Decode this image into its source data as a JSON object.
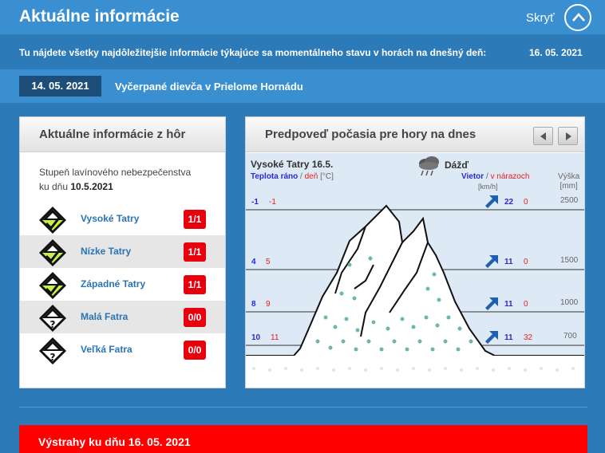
{
  "header": {
    "title": "Aktuálne informácie",
    "hide_label": "Skryť"
  },
  "intro": {
    "text": "Tu nájdete všetky najdôležitejšie informácie týkajúce sa momentálneho stavu v horách na dnešný deň:",
    "date": "16. 05. 2021"
  },
  "news": {
    "date": "14. 05. 2021",
    "headline": "Vyčerpané dievča v Prielome Hornádu"
  },
  "avalanche_panel": {
    "title": "Aktuálne informácie z hôr",
    "subtitle_line1": "Stupeň lavínového nebezpečenstva",
    "subtitle_prefix": "ku dňu",
    "subtitle_date": "10.5.2021",
    "regions": [
      {
        "name": "Vysoké Tatry",
        "level": "1/1",
        "icon": "avalanche-level-1-icon"
      },
      {
        "name": "Nízke Tatry",
        "level": "1/1",
        "icon": "avalanche-level-1-icon"
      },
      {
        "name": "Západné Tatry",
        "level": "1/1",
        "icon": "avalanche-level-1-icon"
      },
      {
        "name": "Malá Fatra",
        "level": "0/0",
        "icon": "avalanche-unknown-icon"
      },
      {
        "name": "Veľká Fatra",
        "level": "0/0",
        "icon": "avalanche-unknown-icon"
      }
    ]
  },
  "forecast_panel": {
    "title": "Predpoveď počasia pre hory na dnes",
    "prev_icon": "chevron-left-icon",
    "next_icon": "chevron-right-icon",
    "region_date": "Vysoké Tatry 16.5.",
    "condition": "Dážď",
    "condition_icon": "rain-cloud-icon",
    "temp_morning_label": "Teplota ráno",
    "temp_sep": "/",
    "temp_day_label": "deň",
    "temp_unit": "[°C]",
    "wind_label": "Vietor",
    "wind_sep": "/",
    "wind_gust_label": "v nárazoch",
    "wind_unit": "[km/h]",
    "alt_label": "Výška",
    "alt_unit": "[mm]",
    "rows": [
      {
        "morning": "-1",
        "day": "-1",
        "wind": "22",
        "gust": "0",
        "altitude": "2500"
      },
      {
        "morning": "4",
        "day": "5",
        "wind": "11",
        "gust": "0",
        "altitude": "1500"
      },
      {
        "morning": "8",
        "day": "9",
        "wind": "11",
        "gust": "0",
        "altitude": "1000"
      },
      {
        "morning": "10",
        "day": "11",
        "wind": "11",
        "gust": "32",
        "altitude": "700"
      }
    ],
    "colors": {
      "temp_morning": "#2a2ad0",
      "temp_day": "#e02020",
      "arrow": "#1f5fb0"
    }
  },
  "warnings": {
    "title": "Výstrahy ku dňu 16. 05. 2021"
  }
}
